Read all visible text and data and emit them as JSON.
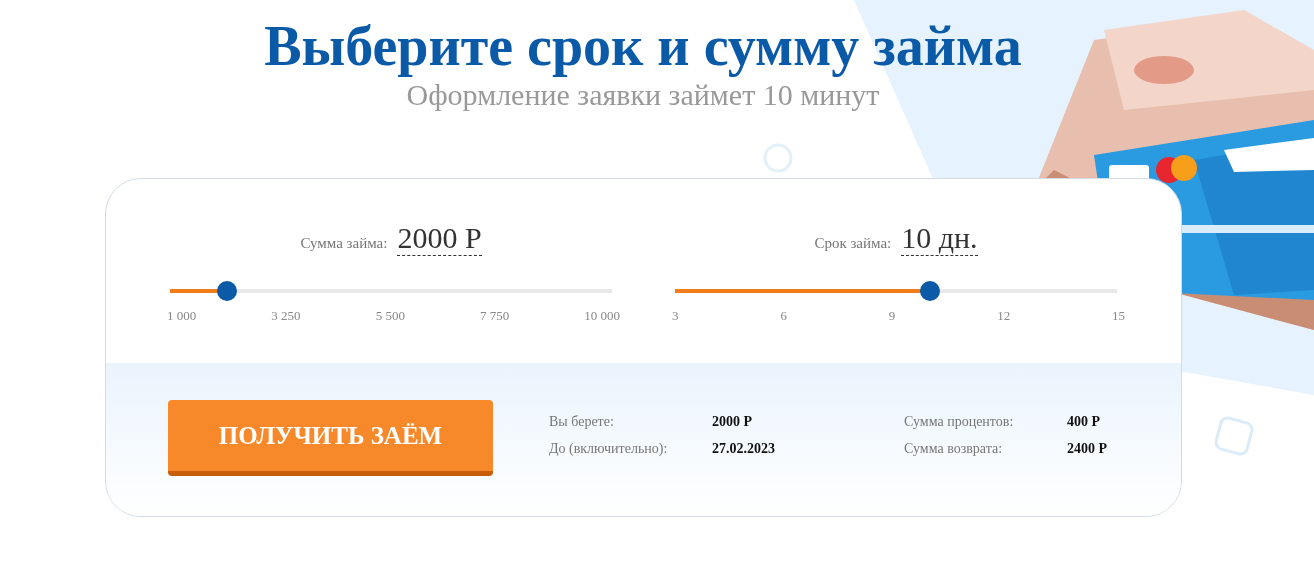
{
  "title": "Выберите срок и сумму займа",
  "subtitle": "Оформление заявки займет 10 минут",
  "sliders": [
    {
      "label": "Сумма займа:",
      "value": "2000 Р",
      "level": 0.13,
      "ticks": [
        "1 000",
        "3 250",
        "5 500",
        "7 750",
        "10 000"
      ]
    },
    {
      "label": "Срок займа:",
      "value": "10 дн.",
      "level": 0.577,
      "ticks": [
        "3",
        "6",
        "9",
        "12",
        "15"
      ]
    }
  ],
  "button": "ПОЛУЧИТЬ ЗАЁМ",
  "summary": [
    {
      "label": "Вы берете:",
      "value": "2000 Р"
    },
    {
      "label": "Сумма процентов:",
      "value": "400 Р"
    },
    {
      "label": "До (включительно):",
      "value": "27.02.2023"
    },
    {
      "label": "Сумма возврата:",
      "value": "2400 Р"
    }
  ]
}
